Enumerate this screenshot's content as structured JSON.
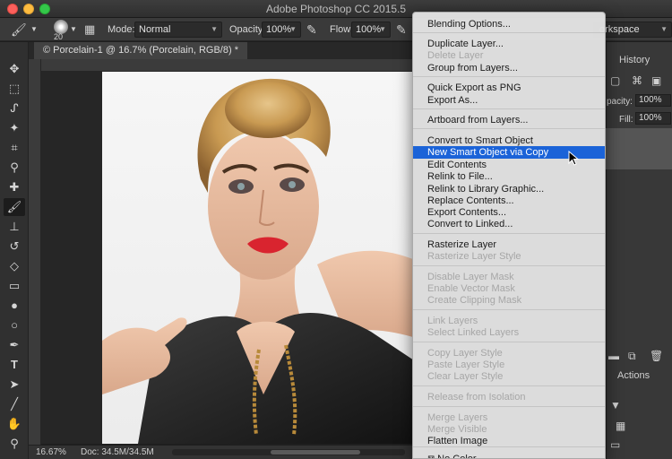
{
  "window": {
    "title": "Adobe Photoshop CC 2015.5"
  },
  "options_bar": {
    "brush_size": "20",
    "mode_label": "Mode:",
    "mode_value": "Normal",
    "opacity_label": "Opacity:",
    "opacity_value": "100%",
    "flow_label": "Flow:",
    "flow_value": "100%",
    "workspace": "orkspace"
  },
  "document": {
    "tab_title": "© Porcelain-1 @ 16.7% (Porcelain, RGB/8) *",
    "zoom": "16.67%",
    "doc_info": "Doc: 34.5M/34.5M"
  },
  "panels": {
    "history_tab": "History",
    "actions_tab": "Actions",
    "opacity_partial": "pacity:",
    "opacity_value": "100%",
    "fill_label": "Fill:",
    "fill_value": "100%"
  },
  "context_menu": {
    "items": [
      {
        "label": "Blending Options...",
        "disabled": false
      },
      {
        "label": "Duplicate Layer...",
        "disabled": false
      },
      {
        "label": "Delete Layer",
        "disabled": true
      },
      {
        "label": "Group from Layers...",
        "disabled": false
      },
      {
        "label": "Quick Export as PNG",
        "disabled": false
      },
      {
        "label": "Export As...",
        "disabled": false
      },
      {
        "label": "Artboard from Layers...",
        "disabled": false
      },
      {
        "label": "Convert to Smart Object",
        "disabled": false
      },
      {
        "label": "New Smart Object via Copy",
        "disabled": false,
        "highlighted": true
      },
      {
        "label": "Edit Contents",
        "disabled": false
      },
      {
        "label": "Relink to File...",
        "disabled": false
      },
      {
        "label": "Relink to Library Graphic...",
        "disabled": false
      },
      {
        "label": "Replace Contents...",
        "disabled": false
      },
      {
        "label": "Export Contents...",
        "disabled": false
      },
      {
        "label": "Convert to Linked...",
        "disabled": false
      },
      {
        "label": "Rasterize Layer",
        "disabled": false
      },
      {
        "label": "Rasterize Layer Style",
        "disabled": true
      },
      {
        "label": "Disable Layer Mask",
        "disabled": true
      },
      {
        "label": "Enable Vector Mask",
        "disabled": true
      },
      {
        "label": "Create Clipping Mask",
        "disabled": true
      },
      {
        "label": "Link Layers",
        "disabled": true
      },
      {
        "label": "Select Linked Layers",
        "disabled": true
      },
      {
        "label": "Copy Layer Style",
        "disabled": true
      },
      {
        "label": "Paste Layer Style",
        "disabled": true
      },
      {
        "label": "Clear Layer Style",
        "disabled": true
      },
      {
        "label": "Release from Isolation",
        "disabled": true
      },
      {
        "label": "Merge Layers",
        "disabled": true
      },
      {
        "label": "Merge Visible",
        "disabled": true
      },
      {
        "label": "Flatten Image",
        "disabled": false
      },
      {
        "label": "No Color",
        "disabled": false
      }
    ]
  },
  "colors": {
    "menu_highlight": "#1b63d8",
    "menu_background": "#e2e2e2",
    "ui_dark": "#383838"
  },
  "icons": {
    "toolbar": [
      "move-icon",
      "marquee-icon",
      "lasso-icon",
      "magic-wand-icon",
      "crop-icon",
      "eyedropper-icon",
      "healing-brush-icon",
      "brush-icon",
      "clone-stamp-icon",
      "history-brush-icon",
      "eraser-icon",
      "gradient-icon",
      "blur-icon",
      "dodge-icon",
      "pen-icon",
      "type-icon",
      "path-selection-icon",
      "line-icon",
      "hand-icon",
      "zoom-icon",
      "more-tools-icon"
    ]
  }
}
